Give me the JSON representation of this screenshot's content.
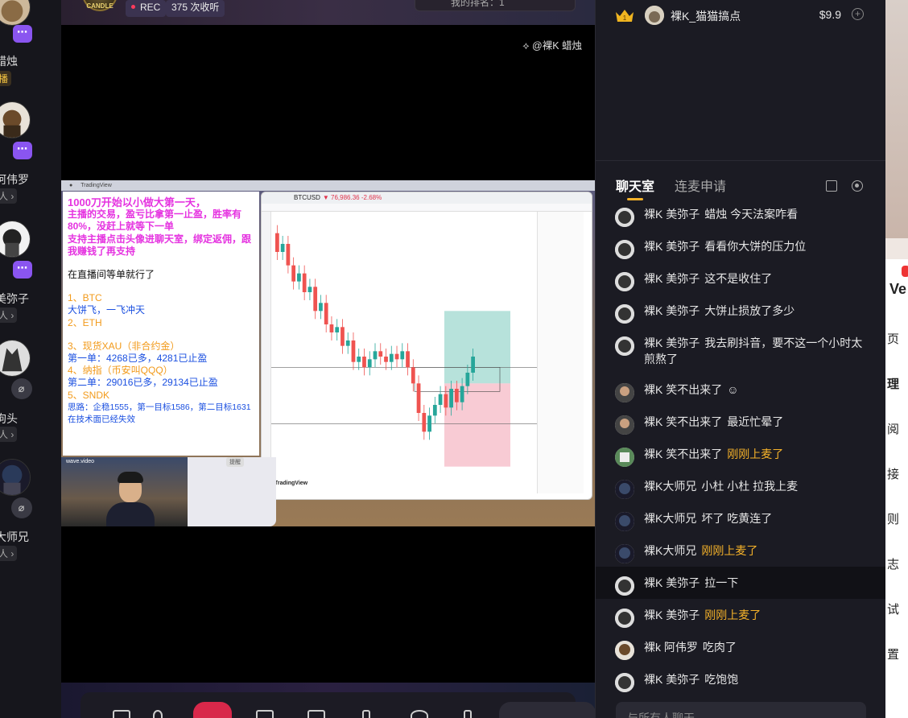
{
  "rail": {
    "guests": [
      {
        "name": "蜡烛",
        "sub": "播",
        "badge": "⋯",
        "sub_style": "gold"
      },
      {
        "name": "阿伟罗",
        "sub": "人 ›",
        "badge": "⋯"
      },
      {
        "name": "美弥子",
        "sub": "人 ›",
        "badge": "⋯"
      },
      {
        "name": "狗头",
        "sub": "人 ›",
        "badge": "mic-off"
      },
      {
        "name": "大师兄",
        "sub": "人 ›",
        "badge": "mic-off"
      }
    ]
  },
  "stage": {
    "rec_label": "REC",
    "collect_label": "375 次收听",
    "rank_text": "我的排名：1",
    "watermark": "@裸K 蜡烛",
    "host_logo_text": "CANDLE"
  },
  "notes": {
    "line1": "1000刀开始以小做大第一天，",
    "line2": "主播的交易，盈亏比拿第一止盈，胜率有80%，没赶上就等下一单",
    "line3": "支持主播点击头像进聊天室，绑定返佣，跟我赚钱了再支持",
    "line4": "在直播间等单就行了",
    "line5": "1、BTC",
    "line6": "大饼飞，一飞冲天",
    "line7": "2、ETH",
    "line8": "3、现货XAU（非合约金）",
    "line9": "第一单：4268已多，4281已止盈",
    "line10": "4、纳指（币安叫QQQ）",
    "line11": "第二单：29016已多，29134已止盈",
    "line12": "5、SNDK",
    "line13": "思路：企稳1555，第一目标1586，第二目标1631 在技术面已经失效"
  },
  "tradingview": {
    "symbol": "BTCUSD",
    "price": "▼ 76,986.36",
    "change": "-2.68%",
    "brand": "TradingView",
    "webcam_label": "wave.video",
    "card_label": "提醒"
  },
  "chat": {
    "gift": {
      "user": "裸K_猫猫搞点",
      "amount": "$9.9",
      "rank": "1"
    },
    "tabs": {
      "chat": "聊天室",
      "mic": "连麦申请"
    },
    "messages": [
      {
        "nick": "裸K 美弥子",
        "text": "蜡烛 今天法案咋看",
        "gold": false
      },
      {
        "nick": "裸K 美弥子",
        "text": "看看你大饼的压力位",
        "gold": false
      },
      {
        "nick": "裸K 美弥子",
        "text": "这不是收住了",
        "gold": false
      },
      {
        "nick": "裸K 美弥子",
        "text": "大饼止损放了多少",
        "gold": false
      },
      {
        "nick": "裸K 美弥子",
        "text": "我去刷抖音，要不这一个小时太煎熬了",
        "gold": false
      },
      {
        "nick": "裸K 笑不出来了",
        "text": "☺",
        "gold": false
      },
      {
        "nick": "裸K 笑不出来了",
        "text": "最近忙晕了",
        "gold": false
      },
      {
        "nick": "裸K 笑不出来了",
        "text": "刚刚上麦了",
        "gold": true
      },
      {
        "nick": "裸K大师兄",
        "text": "小杜 小杜 拉我上麦",
        "gold": false
      },
      {
        "nick": "裸K大师兄",
        "text": "坏了 吃黄连了",
        "gold": false
      },
      {
        "nick": "裸K大师兄",
        "text": "刚刚上麦了",
        "gold": true
      },
      {
        "nick": "裸K 美弥子",
        "text": "拉一下",
        "gold": false
      },
      {
        "nick": "裸K 美弥子",
        "text": "刚刚上麦了",
        "gold": true
      },
      {
        "nick": "裸k 阿伟罗",
        "text": "吃肉了",
        "gold": false
      },
      {
        "nick": "裸K 美弥子",
        "text": "吃饱饱",
        "gold": false
      }
    ],
    "input_placeholder": "与所有人聊天"
  },
  "sliver": {
    "items": [
      "Ve",
      "页",
      "理",
      "阅",
      "接",
      "则",
      "志",
      "试",
      "置"
    ]
  },
  "colors": {
    "accent": "#f5b22a",
    "mic_badge": "#8a55f0",
    "rec": "#ff3b5c"
  },
  "chart_data": {
    "type": "candlestick",
    "symbol": "BTCUSD",
    "price": 76986.36,
    "change_pct": -2.68,
    "candles": [
      [
        0.62,
        0.55
      ],
      [
        0.55,
        0.58
      ],
      [
        0.58,
        0.5
      ],
      [
        0.5,
        0.44
      ],
      [
        0.44,
        0.47
      ],
      [
        0.47,
        0.4
      ],
      [
        0.4,
        0.42
      ],
      [
        0.42,
        0.33
      ],
      [
        0.33,
        0.36
      ],
      [
        0.36,
        0.28
      ],
      [
        0.28,
        0.25
      ],
      [
        0.25,
        0.27
      ],
      [
        0.27,
        0.2
      ],
      [
        0.2,
        0.22
      ],
      [
        0.22,
        0.14
      ],
      [
        0.14,
        0.16
      ],
      [
        0.16,
        0.12
      ],
      [
        0.12,
        0.15
      ],
      [
        0.15,
        0.18
      ],
      [
        0.18,
        0.16
      ],
      [
        0.16,
        0.14
      ],
      [
        0.14,
        0.17
      ],
      [
        0.17,
        0.15
      ],
      [
        0.15,
        0.18
      ],
      [
        0.18,
        0.12
      ],
      [
        0.12,
        0.06
      ],
      [
        0.06,
        -0.05
      ],
      [
        -0.05,
        -0.12
      ],
      [
        -0.12,
        -0.06
      ],
      [
        -0.06,
        -0.02
      ],
      [
        -0.02,
        0.02
      ],
      [
        0.02,
        -0.03
      ],
      [
        -0.03,
        0.04
      ],
      [
        0.04,
        -0.01
      ],
      [
        -0.01,
        0.05
      ],
      [
        0.05,
        0.1
      ],
      [
        0.1,
        0.16
      ]
    ],
    "zones": {
      "tp_top": 0.33,
      "entry": 0.06,
      "sl_bottom": -0.25
    }
  }
}
